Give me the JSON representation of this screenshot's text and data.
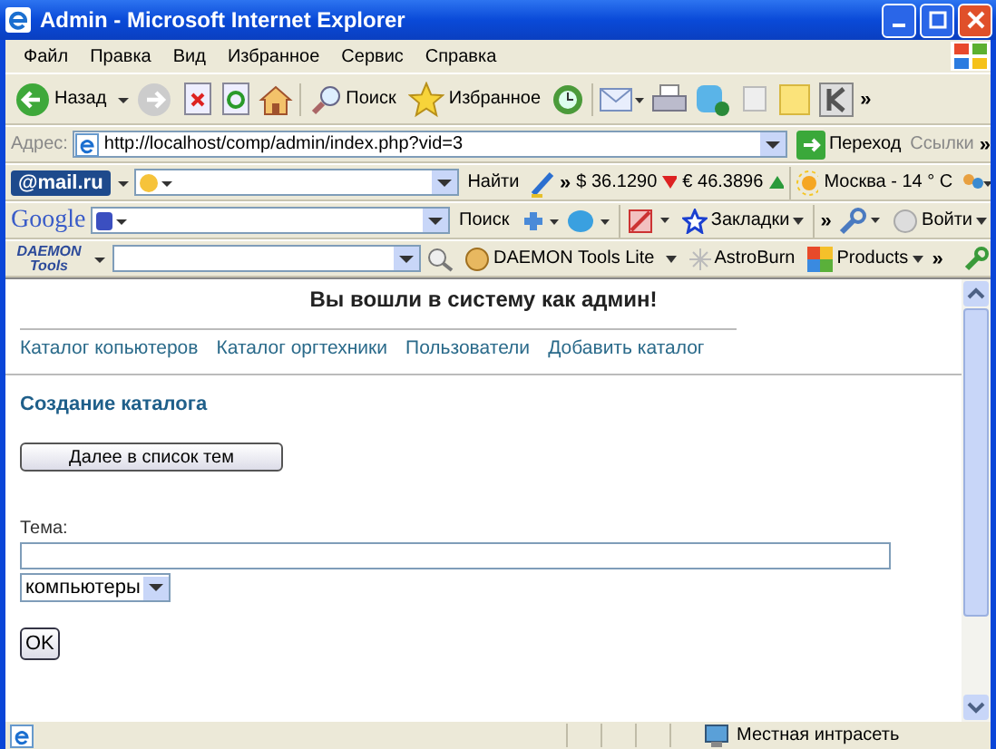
{
  "window": {
    "title": "Admin - Microsoft Internet Explorer"
  },
  "menu": [
    "Файл",
    "Правка",
    "Вид",
    "Избранное",
    "Сервис",
    "Справка"
  ],
  "toolbar": {
    "back": "Назад",
    "search": "Поиск",
    "favorites": "Избранное",
    "more": "»"
  },
  "address_bar": {
    "label": "Адрес:",
    "value": "http://localhost/comp/admin/index.php?vid=3",
    "go": "Переход",
    "links": "Ссылки",
    "more": "»"
  },
  "mail_bar": {
    "logo": "@mail.ru",
    "find": "Найти",
    "more": "»",
    "usd": "$ 36.1290",
    "eur": "€ 46.3896",
    "weather": "Москва  - 14 ° C"
  },
  "google_bar": {
    "logo": "Google",
    "search": "Поиск",
    "bookmarks": "Закладки",
    "more": "»",
    "signin": "Войти"
  },
  "daemon_bar": {
    "logo": "DAEMON Tools",
    "lite": "DAEMON Tools Lite",
    "astroburn": "AstroBurn",
    "products": "Products",
    "more": "»"
  },
  "page": {
    "heading": "Вы вошли в систему как админ!",
    "nav": [
      "Каталог копьютеров",
      "Каталог оргтехники",
      "Пользователи",
      "Добавить каталог"
    ],
    "section_title": "Создание каталога",
    "next_button": "Далее в список тем",
    "topic_label": "Тема:",
    "category": "компьютеры",
    "submit": "OK"
  },
  "status_bar": {
    "zone": "Местная интрасеть"
  }
}
